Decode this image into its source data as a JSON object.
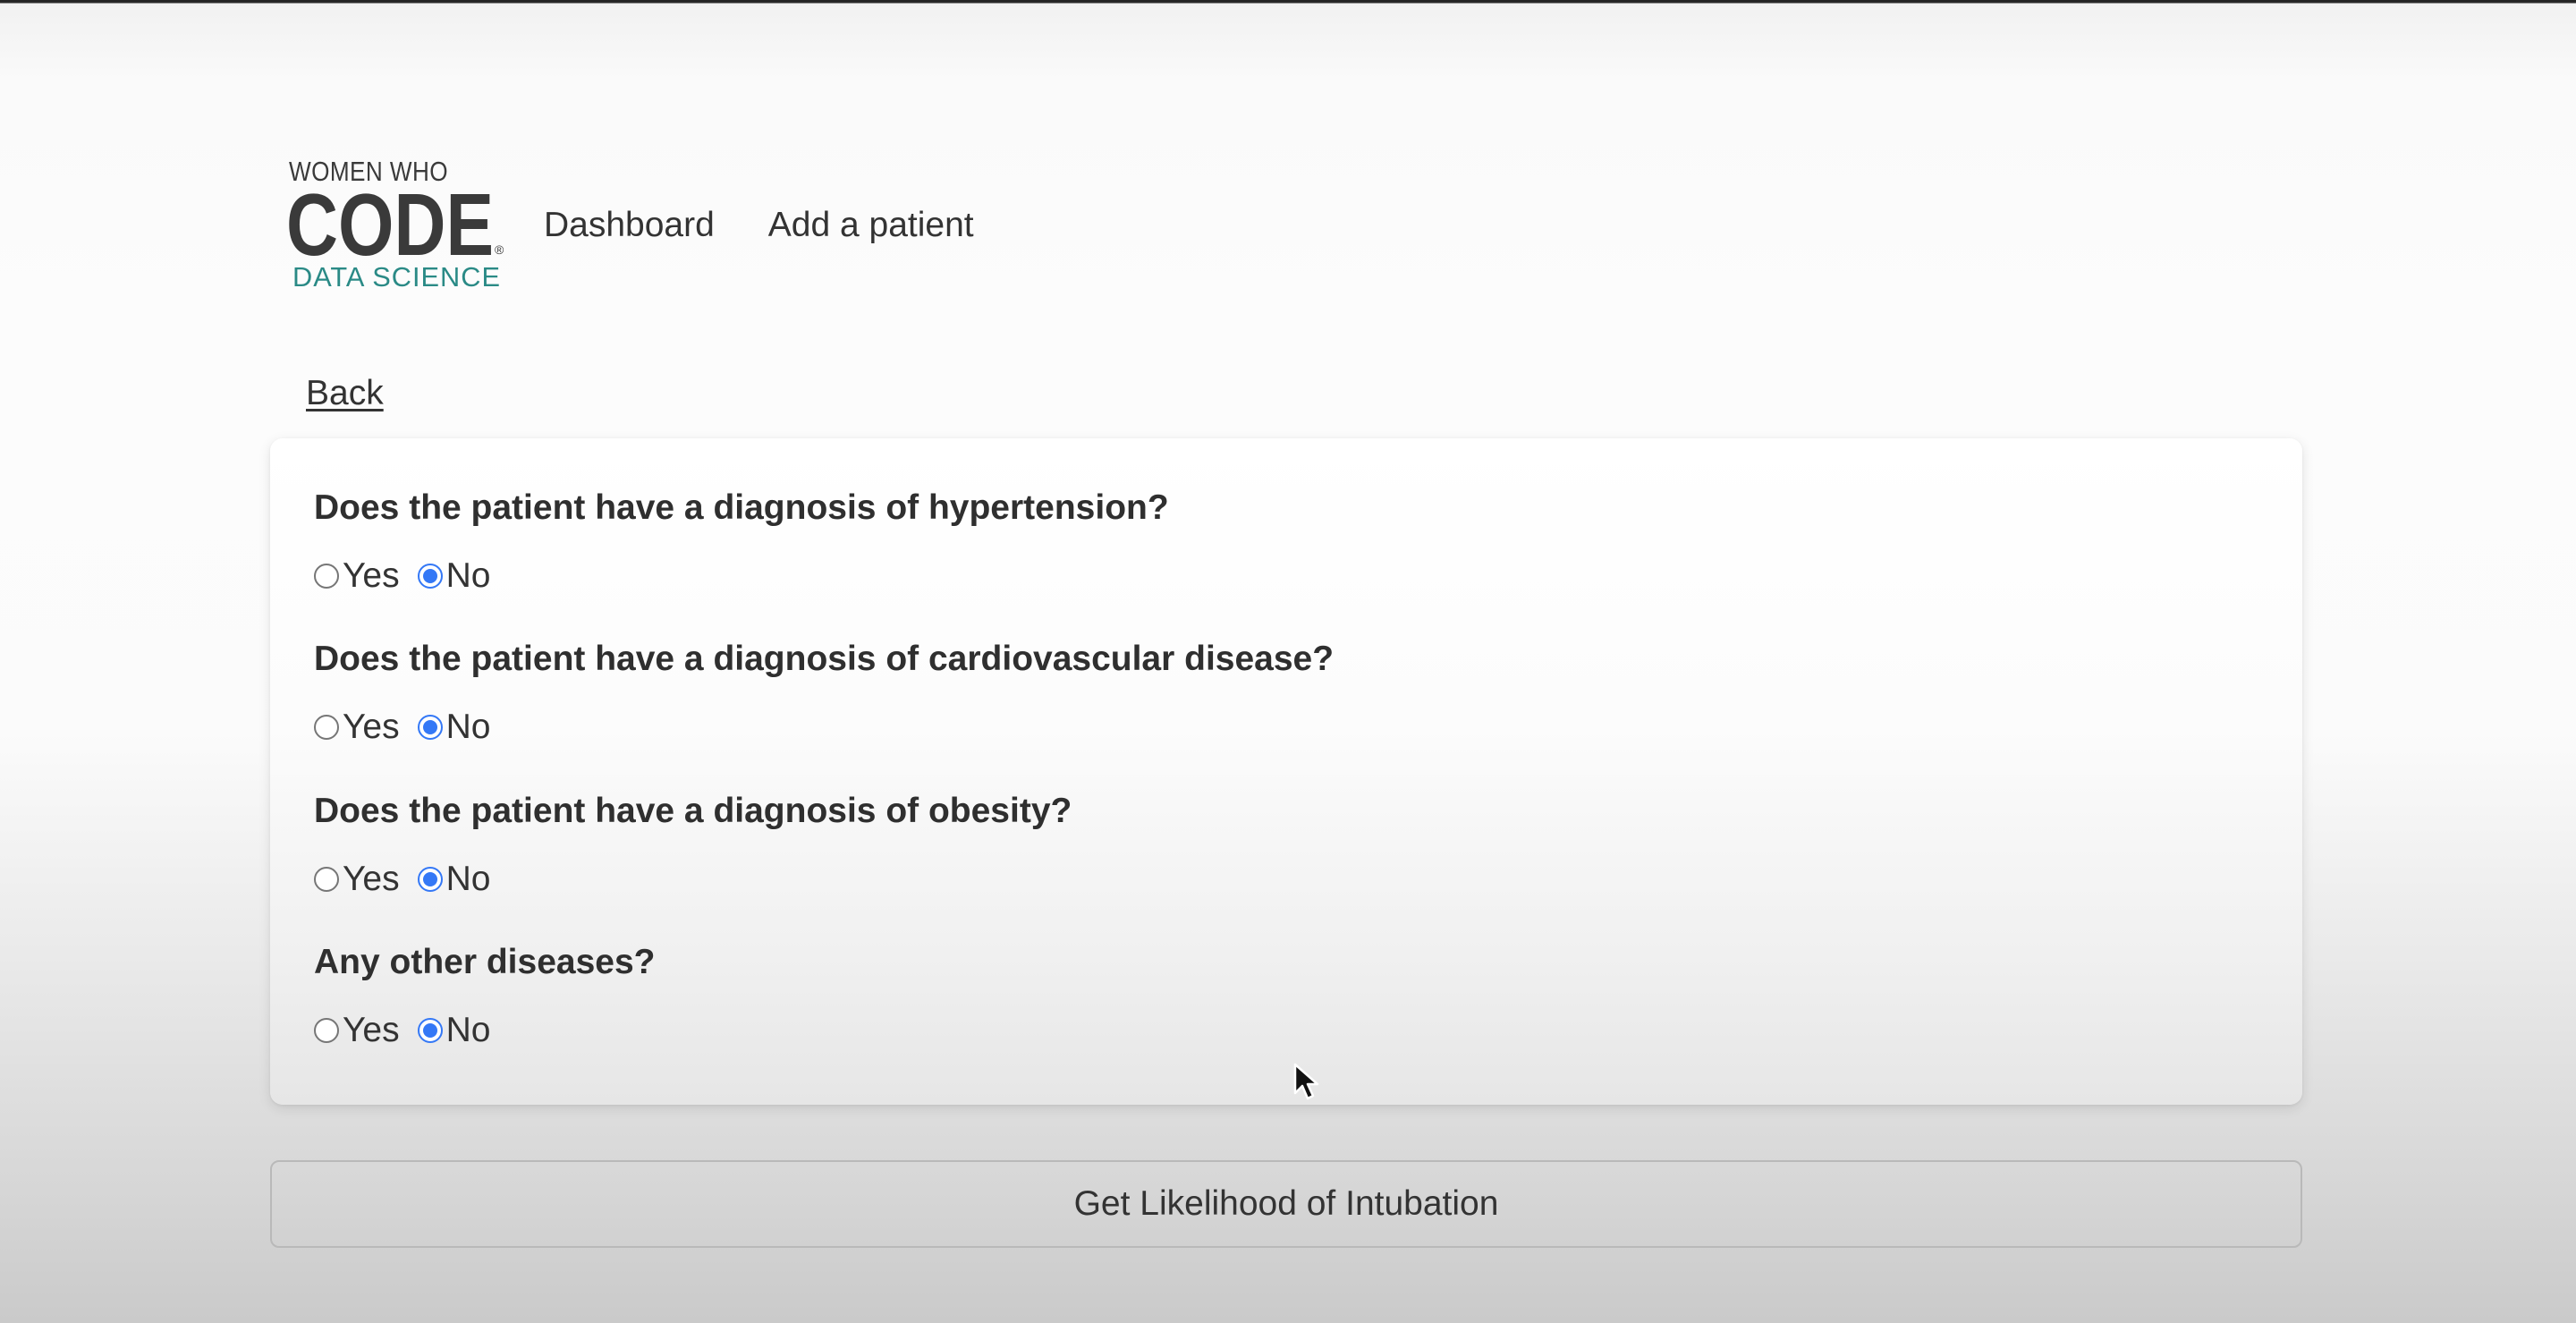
{
  "brand": {
    "logo_line1": "WOMEN WHO",
    "logo_line2": "CODE",
    "logo_line3": "DATA SCIENCE",
    "logo_mark": "®"
  },
  "nav": {
    "items": [
      {
        "label": "Dashboard"
      },
      {
        "label": "Add a patient"
      }
    ]
  },
  "back_link": "Back",
  "form": {
    "questions": [
      {
        "text": "Does the patient have a diagnosis of hypertension?",
        "options": [
          "Yes",
          "No"
        ],
        "selected": "No"
      },
      {
        "text": "Does the patient have a diagnosis of cardiovascular disease?",
        "options": [
          "Yes",
          "No"
        ],
        "selected": "No"
      },
      {
        "text": "Does the patient have a diagnosis of obesity?",
        "options": [
          "Yes",
          "No"
        ],
        "selected": "No"
      },
      {
        "text": "Any other diseases?",
        "options": [
          "Yes",
          "No"
        ],
        "selected": "No"
      }
    ]
  },
  "submit_label": "Get Likelihood of Intubation",
  "colors": {
    "logo_dark": "#3a3a3a",
    "logo_teal": "#2a8a86",
    "radio_checked": "#3478f6",
    "text": "#333333"
  },
  "icons": {
    "cursor": "arrow-pointer-icon"
  }
}
